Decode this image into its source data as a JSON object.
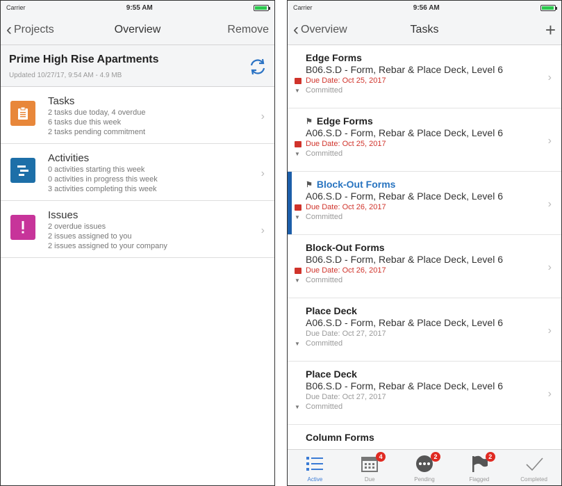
{
  "left": {
    "status": {
      "carrier": "Carrier",
      "time": "9:55 AM"
    },
    "nav": {
      "back": "Projects",
      "title": "Overview",
      "action": "Remove"
    },
    "project": {
      "name": "Prime High Rise Apartments",
      "meta": "Updated 10/27/17, 9:54 AM - 4.9 MB"
    },
    "categories": [
      {
        "title": "Tasks",
        "lines": [
          "2 tasks due today, 4 overdue",
          "6 tasks due this week",
          "2 tasks pending commitment"
        ],
        "color": "#e8873a",
        "icon": "clipboard-icon"
      },
      {
        "title": "Activities",
        "lines": [
          "0 activities starting this week",
          "0 activities in progress this week",
          "3 activities completing this week"
        ],
        "color": "#1d6fa8",
        "icon": "gantt-icon"
      },
      {
        "title": "Issues",
        "lines": [
          "2 overdue issues",
          "2 issues assigned to you",
          "2 issues assigned to your company"
        ],
        "color": "#c7349a",
        "icon": "exclamation-icon"
      }
    ]
  },
  "right": {
    "status": {
      "carrier": "Carrier",
      "time": "9:56 AM"
    },
    "nav": {
      "back": "Overview",
      "title": "Tasks",
      "action": "+"
    },
    "tasks": [
      {
        "title": "Edge Forms",
        "sub": "B06.S.D - Form, Rebar & Place Deck, Level 6",
        "due": "Due Date: Oct 25, 2017",
        "status": "Committed",
        "overdue": true,
        "flag": false,
        "selected": false
      },
      {
        "title": "Edge Forms",
        "sub": "A06.S.D - Form, Rebar & Place Deck, Level 6",
        "due": "Due Date: Oct 25, 2017",
        "status": "Committed",
        "overdue": true,
        "flag": true,
        "selected": false
      },
      {
        "title": "Block-Out Forms",
        "sub": "A06.S.D - Form, Rebar & Place Deck, Level 6",
        "due": "Due Date: Oct 26, 2017",
        "status": "Committed",
        "overdue": true,
        "flag": true,
        "selected": true
      },
      {
        "title": "Block-Out Forms",
        "sub": "B06.S.D - Form, Rebar & Place Deck, Level 6",
        "due": "Due Date: Oct 26, 2017",
        "status": "Committed",
        "overdue": true,
        "flag": false,
        "selected": false
      },
      {
        "title": "Place Deck",
        "sub": "A06.S.D - Form, Rebar & Place Deck, Level 6",
        "due": "Due Date: Oct 27, 2017",
        "status": "Committed",
        "overdue": false,
        "flag": false,
        "selected": false
      },
      {
        "title": "Place Deck",
        "sub": "B06.S.D - Form, Rebar & Place Deck, Level 6",
        "due": "Due Date: Oct 27, 2017",
        "status": "Committed",
        "overdue": false,
        "flag": false,
        "selected": false
      },
      {
        "title": "Column Forms",
        "sub": "",
        "due": "",
        "status": "",
        "overdue": false,
        "flag": false,
        "selected": false
      }
    ],
    "tabs": [
      {
        "label": "Active",
        "icon": "list-icon",
        "badge": "",
        "active": true
      },
      {
        "label": "Due",
        "icon": "calendar-icon",
        "badge": "4",
        "active": false
      },
      {
        "label": "Pending",
        "icon": "ellipsis-icon",
        "badge": "2",
        "active": false
      },
      {
        "label": "Flagged",
        "icon": "flag-icon",
        "badge": "2",
        "active": false
      },
      {
        "label": "Completed",
        "icon": "checkmark-icon",
        "badge": "",
        "active": false
      }
    ]
  }
}
